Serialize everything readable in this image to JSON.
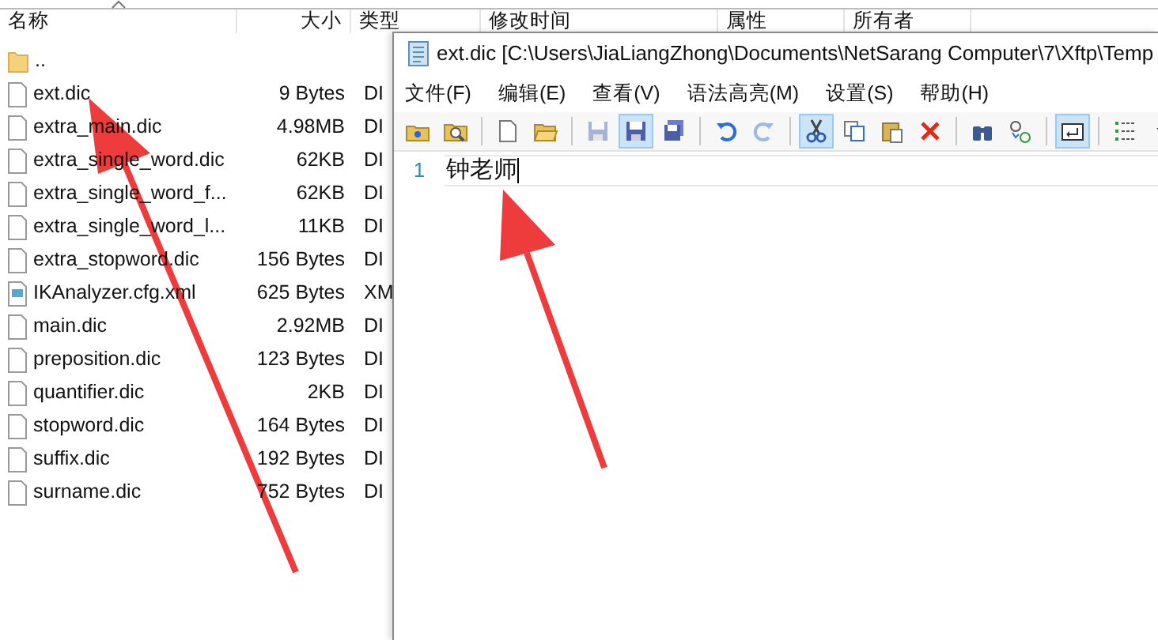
{
  "file_list": {
    "columns": [
      {
        "label": "名称"
      },
      {
        "label": "大小"
      },
      {
        "label": "类型"
      },
      {
        "label": "修改时间"
      },
      {
        "label": "属性"
      },
      {
        "label": "所有者"
      }
    ],
    "rows": [
      {
        "kind": "folder",
        "name": ".."
      },
      {
        "kind": "file",
        "name": "ext.dic",
        "size": "9 Bytes",
        "type": "DI"
      },
      {
        "kind": "file",
        "name": "extra_main.dic",
        "size": "4.98MB",
        "type": "DI"
      },
      {
        "kind": "file",
        "name": "extra_single_word.dic",
        "size": "62KB",
        "type": "DI"
      },
      {
        "kind": "file",
        "name": "extra_single_word_f...",
        "size": "62KB",
        "type": "DI"
      },
      {
        "kind": "file",
        "name": "extra_single_word_l...",
        "size": "11KB",
        "type": "DI"
      },
      {
        "kind": "file",
        "name": "extra_stopword.dic",
        "size": "156 Bytes",
        "type": "DI"
      },
      {
        "kind": "xml",
        "name": "IKAnalyzer.cfg.xml",
        "size": "625 Bytes",
        "type": "XM"
      },
      {
        "kind": "file",
        "name": "main.dic",
        "size": "2.92MB",
        "type": "DI"
      },
      {
        "kind": "file",
        "name": "preposition.dic",
        "size": "123 Bytes",
        "type": "DI"
      },
      {
        "kind": "file",
        "name": "quantifier.dic",
        "size": "2KB",
        "type": "DI"
      },
      {
        "kind": "file",
        "name": "stopword.dic",
        "size": "164 Bytes",
        "type": "DI"
      },
      {
        "kind": "file",
        "name": "suffix.dic",
        "size": "192 Bytes",
        "type": "DI"
      },
      {
        "kind": "file",
        "name": "surname.dic",
        "size": "752 Bytes",
        "type": "DI"
      }
    ]
  },
  "editor": {
    "title": "ext.dic [C:\\Users\\JiaLiangZhong\\Documents\\NetSarang Computer\\7\\Xftp\\Temp",
    "menu": [
      "文件(F)",
      "编辑(E)",
      "查看(V)",
      "语法高亮(M)",
      "设置(S)",
      "帮助(H)"
    ],
    "toolbar": [
      {
        "kind": "folder-star",
        "pressed": false,
        "disabled": false
      },
      {
        "kind": "folder-search",
        "pressed": false,
        "disabled": false
      },
      {
        "kind": "separator"
      },
      {
        "kind": "new",
        "pressed": false,
        "disabled": false
      },
      {
        "kind": "open",
        "pressed": false,
        "disabled": false
      },
      {
        "kind": "separator"
      },
      {
        "kind": "save",
        "pressed": false,
        "disabled": true
      },
      {
        "kind": "save",
        "pressed": true,
        "disabled": false
      },
      {
        "kind": "save-all",
        "pressed": false,
        "disabled": false
      },
      {
        "kind": "separator"
      },
      {
        "kind": "undo",
        "pressed": false,
        "disabled": false
      },
      {
        "kind": "redo",
        "pressed": false,
        "disabled": true
      },
      {
        "kind": "separator"
      },
      {
        "kind": "cut",
        "pressed": true,
        "disabled": false
      },
      {
        "kind": "copy",
        "pressed": false,
        "disabled": false
      },
      {
        "kind": "paste",
        "pressed": false,
        "disabled": false
      },
      {
        "kind": "delete",
        "pressed": false,
        "disabled": false
      },
      {
        "kind": "separator"
      },
      {
        "kind": "find",
        "pressed": false,
        "disabled": false
      },
      {
        "kind": "replace",
        "pressed": false,
        "disabled": false
      },
      {
        "kind": "separator"
      },
      {
        "kind": "wrap",
        "pressed": true,
        "disabled": false
      },
      {
        "kind": "separator"
      },
      {
        "kind": "list",
        "pressed": false,
        "disabled": false
      },
      {
        "kind": "dropdown",
        "pressed": false,
        "disabled": false
      }
    ],
    "lines": [
      {
        "number": "1",
        "text": "钟老师"
      }
    ]
  }
}
